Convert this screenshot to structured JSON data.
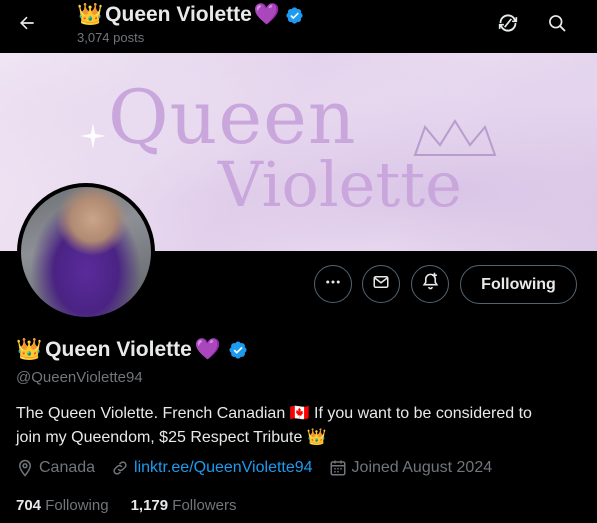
{
  "header": {
    "title_prefix_emoji": "👑",
    "title": "Queen Violette",
    "title_suffix_emoji": "💜",
    "posts_count": "3,074 posts",
    "icons": [
      "back-arrow-icon",
      "refresh-icon",
      "search-icon"
    ]
  },
  "banner": {
    "line1": "Queen",
    "line2": "Violette"
  },
  "actions": {
    "following_label": "Following",
    "icons": [
      "more-icon",
      "message-icon",
      "notification-bell-icon"
    ]
  },
  "profile": {
    "name_prefix_emoji": "👑",
    "name": "Queen Violette",
    "name_suffix_emoji": "💜",
    "handle": "@QueenViolette94",
    "bio_line1": "The Queen Violette. French Canadian 🇨🇦 If you want to be considered to",
    "bio_line2": "join my Queendom, $25 Respect Tribute 👑",
    "location": "Canada",
    "link": "linktr.ee/QueenViolette94",
    "joined": "Joined August 2024",
    "following_count": "704",
    "following_label": "Following",
    "followers_count": "1,179",
    "followers_label": "Followers"
  },
  "colors": {
    "accent": "#1d9bf0",
    "verified": "#1d9bf0",
    "muted": "#71767b"
  }
}
